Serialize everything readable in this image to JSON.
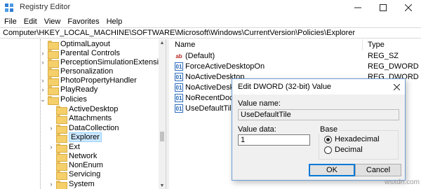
{
  "window": {
    "title": "Registry Editor",
    "minimize_icon": "minimize-icon",
    "maximize_icon": "maximize-icon",
    "close_icon": "close-icon"
  },
  "menu": [
    "File",
    "Edit",
    "View",
    "Favorites",
    "Help"
  ],
  "address": "Computer\\HKEY_LOCAL_MACHINE\\SOFTWARE\\Microsoft\\Windows\\CurrentVersion\\Policies\\Explorer",
  "tree": {
    "items": [
      {
        "label": "OptimalLayout"
      },
      {
        "label": "Parental Controls"
      },
      {
        "label": "PerceptionSimulationExtensions"
      },
      {
        "label": "Personalization"
      },
      {
        "label": "PhotoPropertyHandler"
      },
      {
        "label": "PlayReady"
      },
      {
        "label": "Policies"
      },
      {
        "label": "ActiveDesktop"
      },
      {
        "label": "Attachments"
      },
      {
        "label": "DataCollection"
      },
      {
        "label": "Explorer",
        "selected": true
      },
      {
        "label": "Ext"
      },
      {
        "label": "Network"
      },
      {
        "label": "NonEnum"
      },
      {
        "label": "Servicing"
      },
      {
        "label": "System"
      }
    ]
  },
  "list": {
    "col_name": "Name",
    "col_type": "Type",
    "rows": [
      {
        "name": "(Default)",
        "type": "REG_SZ",
        "icon": "string-value-icon"
      },
      {
        "name": "ForceActiveDesktopOn",
        "type": "REG_DWORD",
        "icon": "dword-value-icon"
      },
      {
        "name": "NoActiveDesktop",
        "type": "REG_DWORD",
        "icon": "dword-value-icon"
      },
      {
        "name": "NoActiveDesktopC",
        "type": "",
        "icon": "dword-value-icon"
      },
      {
        "name": "NoRecentDocsHis",
        "type": "",
        "icon": "dword-value-icon"
      },
      {
        "name": "UseDefaultTile",
        "type": "",
        "icon": "dword-value-icon"
      }
    ]
  },
  "dialog": {
    "title": "Edit DWORD (32-bit) Value",
    "value_name_label": "Value name:",
    "value_name": "UseDefaultTile",
    "value_data_label": "Value data:",
    "value_data": "1",
    "base_label": "Base",
    "hex_label": "Hexadecimal",
    "dec_label": "Decimal",
    "base_selected": "Hexadecimal",
    "ok_label": "OK",
    "cancel_label": "Cancel"
  },
  "watermark": "wsxdn.com"
}
